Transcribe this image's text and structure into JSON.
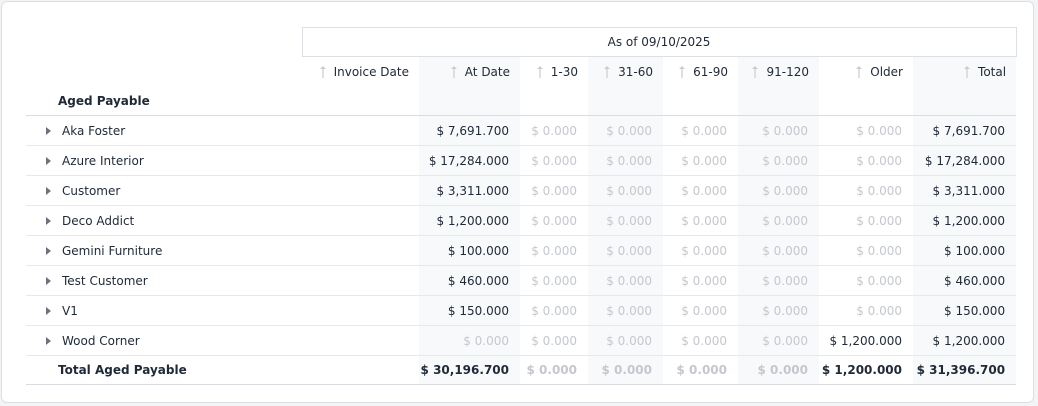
{
  "report": {
    "as_of_label": "As of 09/10/2025",
    "section_title": "Aged Payable",
    "columns": [
      "Invoice Date",
      "At Date",
      "1-30",
      "31-60",
      "61-90",
      "91-120",
      "Older",
      "Total"
    ],
    "rows": [
      {
        "name": "Aka Foster",
        "invoice_date": "",
        "values": [
          "$ 7,691.700",
          "$ 0.000",
          "$ 0.000",
          "$ 0.000",
          "$ 0.000",
          "$ 0.000",
          "$ 7,691.700"
        ]
      },
      {
        "name": "Azure Interior",
        "invoice_date": "",
        "values": [
          "$ 17,284.000",
          "$ 0.000",
          "$ 0.000",
          "$ 0.000",
          "$ 0.000",
          "$ 0.000",
          "$ 17,284.000"
        ]
      },
      {
        "name": "Customer",
        "invoice_date": "",
        "values": [
          "$ 3,311.000",
          "$ 0.000",
          "$ 0.000",
          "$ 0.000",
          "$ 0.000",
          "$ 0.000",
          "$ 3,311.000"
        ]
      },
      {
        "name": "Deco Addict",
        "invoice_date": "",
        "values": [
          "$ 1,200.000",
          "$ 0.000",
          "$ 0.000",
          "$ 0.000",
          "$ 0.000",
          "$ 0.000",
          "$ 1,200.000"
        ]
      },
      {
        "name": "Gemini Furniture",
        "invoice_date": "",
        "values": [
          "$ 100.000",
          "$ 0.000",
          "$ 0.000",
          "$ 0.000",
          "$ 0.000",
          "$ 0.000",
          "$ 100.000"
        ]
      },
      {
        "name": "Test Customer",
        "invoice_date": "",
        "values": [
          "$ 460.000",
          "$ 0.000",
          "$ 0.000",
          "$ 0.000",
          "$ 0.000",
          "$ 0.000",
          "$ 460.000"
        ]
      },
      {
        "name": "V1",
        "invoice_date": "",
        "values": [
          "$ 150.000",
          "$ 0.000",
          "$ 0.000",
          "$ 0.000",
          "$ 0.000",
          "$ 0.000",
          "$ 150.000"
        ]
      },
      {
        "name": "Wood Corner",
        "invoice_date": "",
        "values": [
          "$ 0.000",
          "$ 0.000",
          "$ 0.000",
          "$ 0.000",
          "$ 0.000",
          "$ 1,200.000",
          "$ 1,200.000"
        ]
      }
    ],
    "total": {
      "label": "Total Aged Payable",
      "values": [
        "$ 30,196.700",
        "$ 0.000",
        "$ 0.000",
        "$ 0.000",
        "$ 0.000",
        "$ 1,200.000",
        "$ 31,396.700"
      ]
    }
  },
  "colors": {
    "zero_value": "#c4c8ce",
    "shaded_column": "#f8f9fb",
    "border": "#dcdfe4"
  },
  "icons": {
    "sort": "sort-icon",
    "expand": "caret-right-icon"
  }
}
